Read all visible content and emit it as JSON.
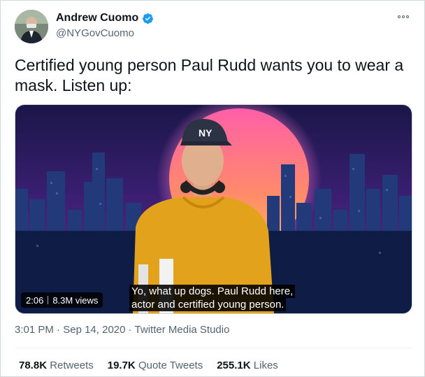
{
  "author": {
    "name": "Andrew Cuomo",
    "handle": "@NYGovCuomo",
    "verified": true,
    "verified_color": "#1d9bf0"
  },
  "tweet": {
    "text": "Certified young person Paul Rudd wants you to wear a mask. Listen up:"
  },
  "video": {
    "duration": "2:06",
    "views": "8.3M views",
    "caption_line1": "Yo, what up dogs. Paul Rudd here,",
    "caption_line2": "actor and certified young person.",
    "cap_text": "NY"
  },
  "meta": {
    "time": "3:01 PM",
    "date": "Sep 14, 2020",
    "source": "Twitter Media Studio",
    "separator": "·"
  },
  "stats": [
    {
      "value": "78.8K",
      "label": "Retweets"
    },
    {
      "value": "19.7K",
      "label": "Quote Tweets"
    },
    {
      "value": "255.1K",
      "label": "Likes"
    }
  ],
  "icons": {
    "verified": "verified-badge-icon",
    "more": "more-options-icon"
  }
}
